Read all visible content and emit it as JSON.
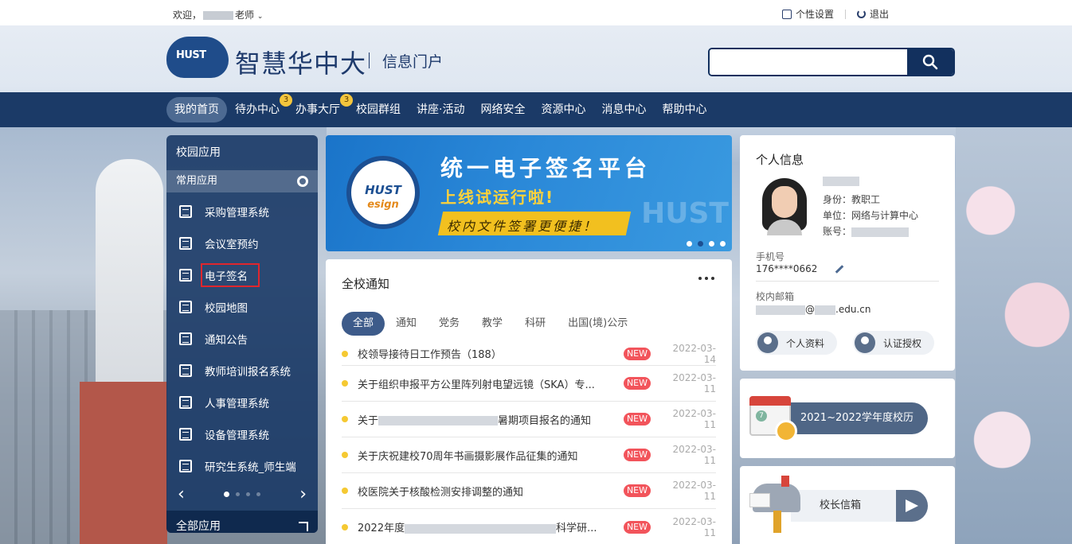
{
  "topbar": {
    "welcome_prefix": "欢迎，",
    "welcome_suffix": "老师",
    "settings_label": "个性设置",
    "logout_label": "退出"
  },
  "header": {
    "logo_badge": "HUST",
    "logo_title": "智慧华中大",
    "logo_subtitle": "信息门户",
    "search": {
      "value": "",
      "placeholder": ""
    }
  },
  "nav": {
    "items": [
      {
        "label": "我的首页",
        "active": true
      },
      {
        "label": "待办中心",
        "badge": "3"
      },
      {
        "label": "办事大厅",
        "badge": "3"
      },
      {
        "label": "校园群组"
      },
      {
        "label": "讲座·活动"
      },
      {
        "label": "网络安全"
      },
      {
        "label": "资源中心"
      },
      {
        "label": "消息中心"
      },
      {
        "label": "帮助中心"
      }
    ]
  },
  "sidebar": {
    "title": "校园应用",
    "common_label": "常用应用",
    "items": [
      {
        "label": "采购管理系统"
      },
      {
        "label": "会议室预约"
      },
      {
        "label": "电子签名",
        "highlighted": true
      },
      {
        "label": "校园地图"
      },
      {
        "label": "通知公告"
      },
      {
        "label": "教师培训报名系统"
      },
      {
        "label": "人事管理系统"
      },
      {
        "label": "设备管理系统"
      },
      {
        "label": "研究生系统_师生端"
      }
    ],
    "pager_prev": "‹",
    "pager_next": "›",
    "all_apps_label": "全部应用"
  },
  "banner": {
    "badge_main": "HUST",
    "badge_sub": "esign",
    "title": "统一电子签名平台",
    "subtitle": "上线试运行啦!",
    "strip": "校内文件签署更便捷！",
    "watermark": "HUST"
  },
  "notice": {
    "title": "全校通知",
    "tabs": [
      {
        "label": "全部",
        "active": true
      },
      {
        "label": "通知"
      },
      {
        "label": "党务"
      },
      {
        "label": "教学"
      },
      {
        "label": "科研"
      },
      {
        "label": "出国(境)公示"
      }
    ],
    "new_label": "NEW",
    "items": [
      {
        "title": "校领导接待日工作预告（188）",
        "date": "2022-03-14"
      },
      {
        "title": "关于组织申报平方公里阵列射电望远镜（SKA）专...",
        "date": "2022-03-11"
      },
      {
        "title_prefix": "关于",
        "title_suffix": "暑期项目报名的通知",
        "date": "2022-03-11"
      },
      {
        "title": "关于庆祝建校70周年书画摄影展作品征集的通知",
        "date": "2022-03-11"
      },
      {
        "title": "校医院关于核酸检测安排调整的通知",
        "date": "2022-03-11"
      },
      {
        "title_prefix": "2022年度",
        "title_suffix": "科学研...",
        "date": "2022-03-11"
      }
    ]
  },
  "profile": {
    "title": "个人信息",
    "identity_label": "身份：",
    "identity_value": "教职工",
    "unit_label": "单位：",
    "unit_value": "网络与计算中心",
    "account_label": "账号：",
    "phone_label": "手机号",
    "phone_value": "176****0662",
    "email_label": "校内邮箱",
    "email_at": "@",
    "email_domain": ".edu.cn",
    "btn_profile": "个人资料",
    "btn_auth": "认证授权"
  },
  "calendar": {
    "label": "2021~2022学年度校历",
    "icon_num": "7"
  },
  "mailbox": {
    "label": "校长信箱"
  }
}
